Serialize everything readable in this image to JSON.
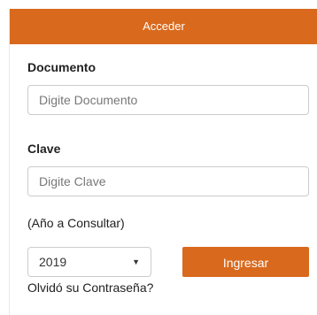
{
  "header": {
    "title": "Acceder"
  },
  "form": {
    "document_label": "Documento",
    "document_placeholder": "Digite Documento",
    "password_label": "Clave",
    "password_placeholder": "Digite Clave",
    "year_label": "(Año a Consultar)",
    "year_value": "2019",
    "year_arrow": "▼",
    "submit_label": "Ingresar",
    "forgot_label": "Olvidó su Contraseña?"
  },
  "colors": {
    "accent": "#d8691d"
  }
}
